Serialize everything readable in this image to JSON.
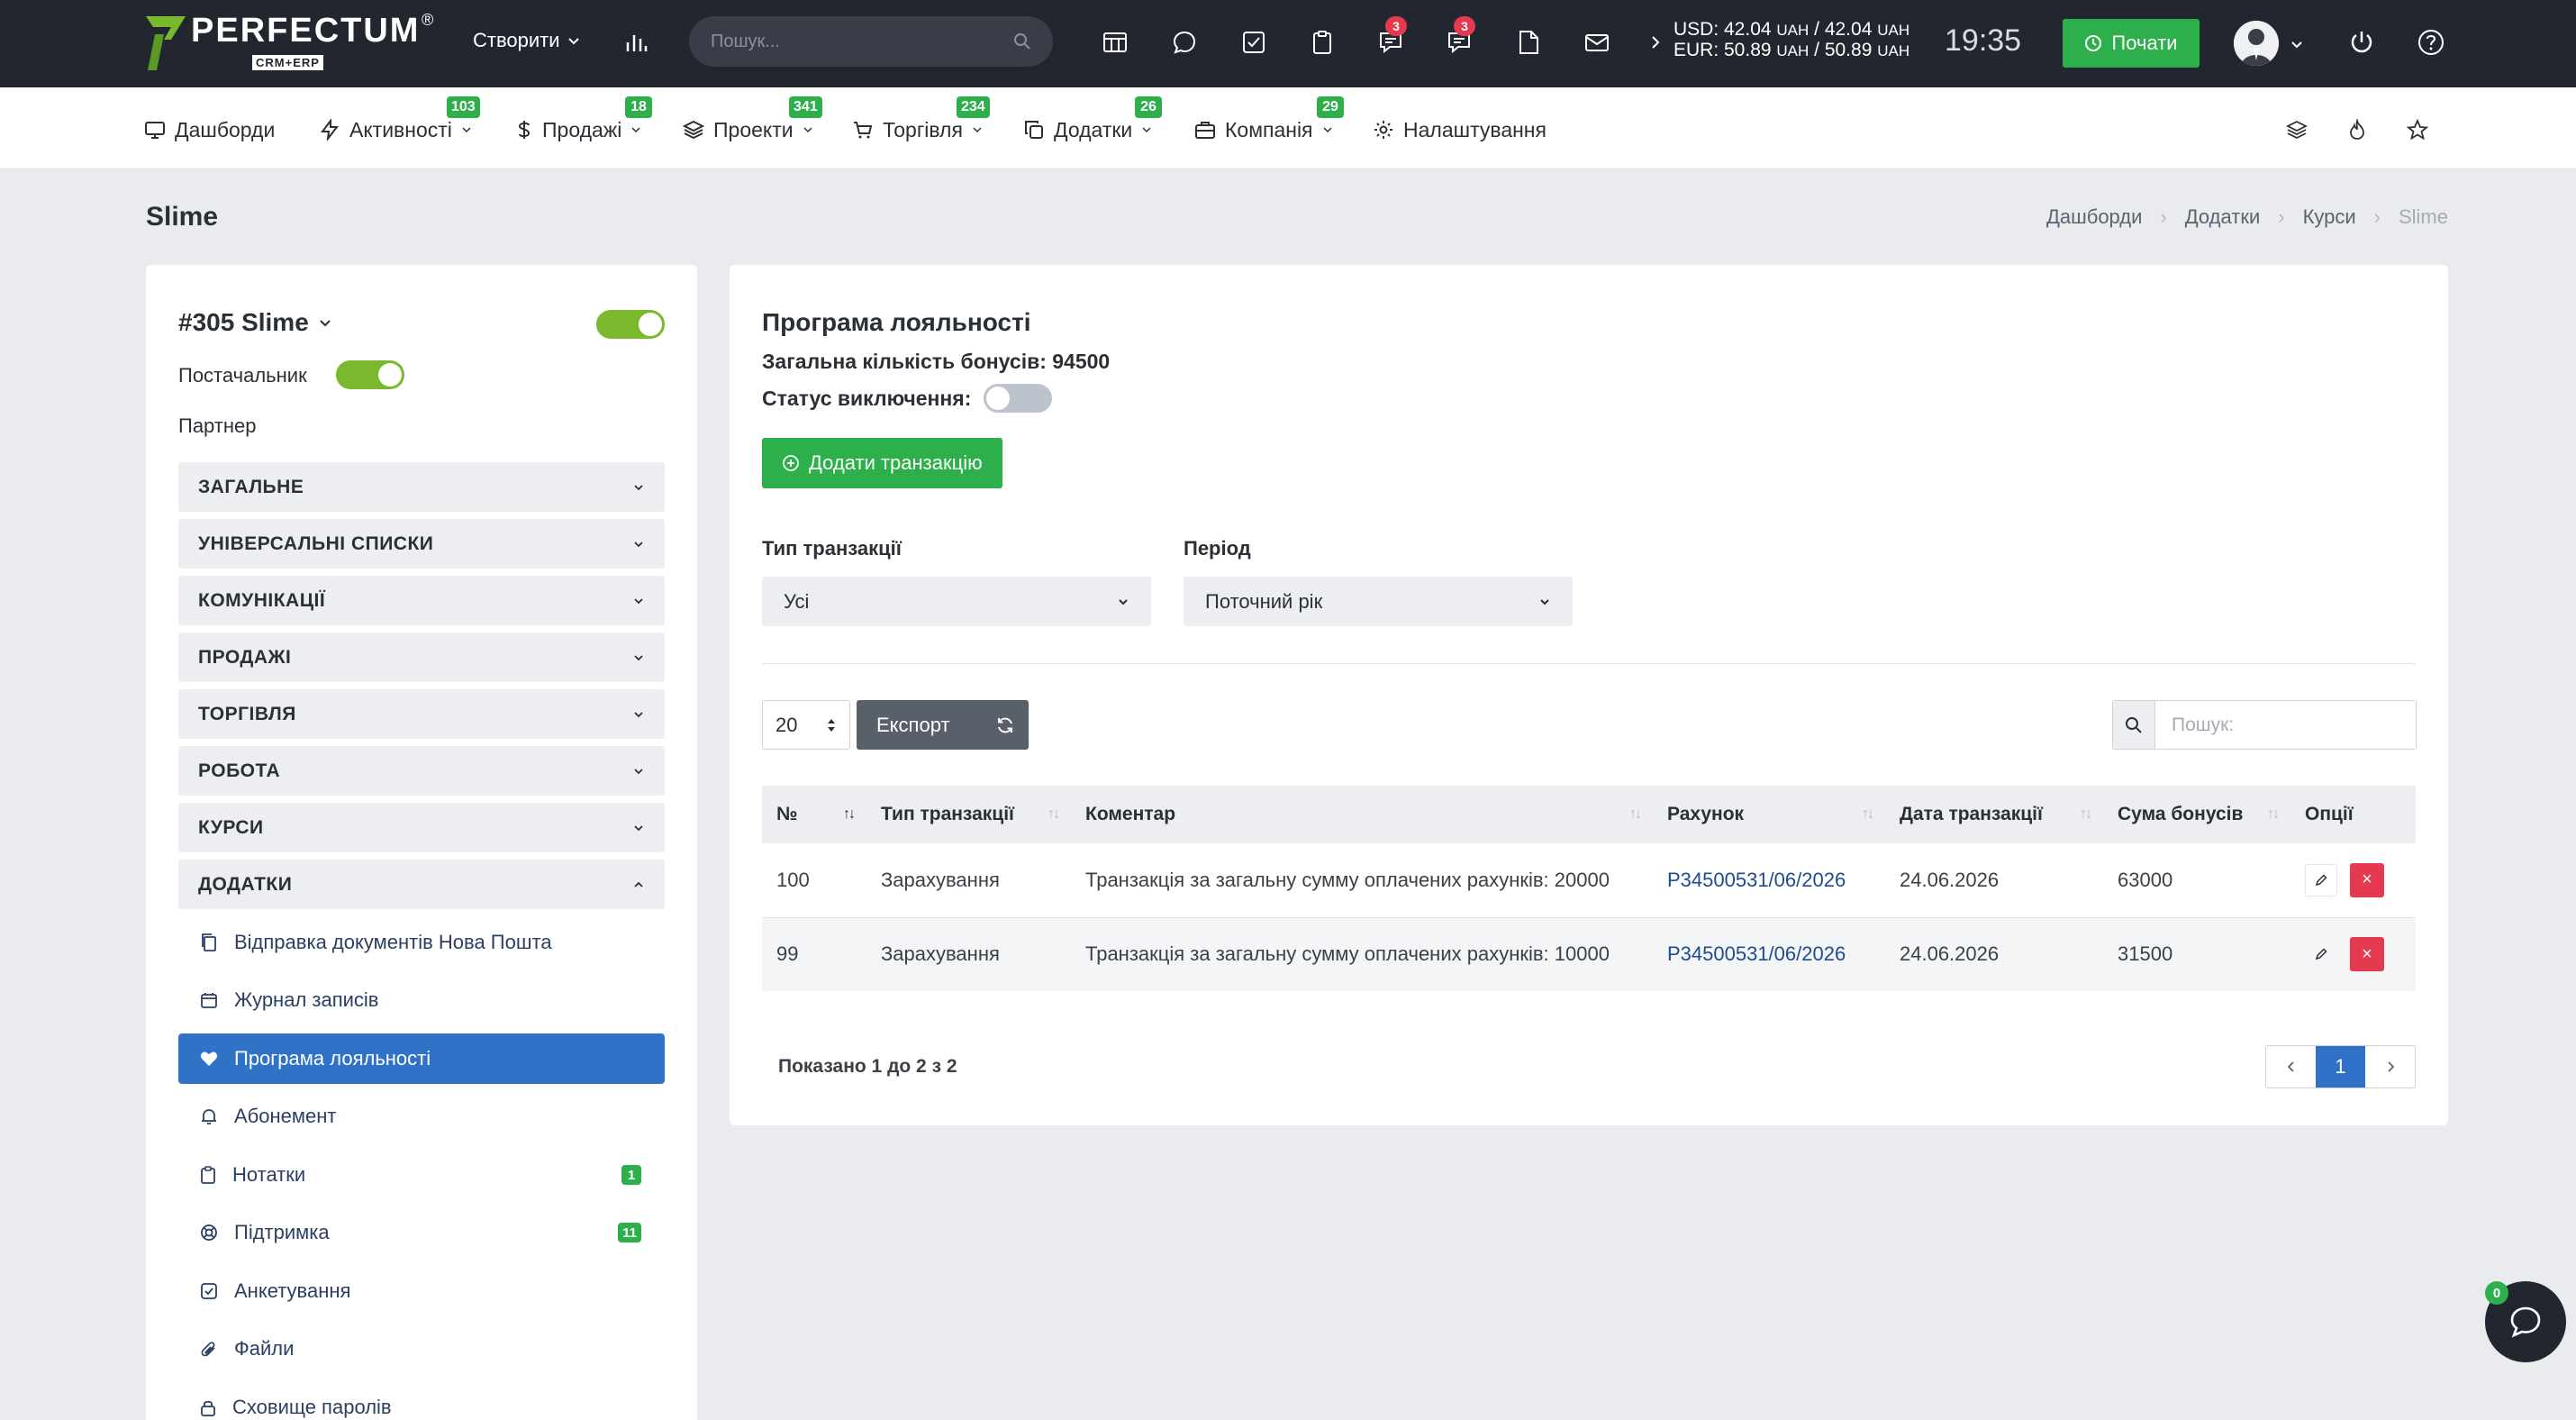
{
  "app": {
    "brand": "PERFECTUM",
    "brand_sub": "CRM+ERP",
    "brand_reg": "®"
  },
  "topbar": {
    "create_label": "Створити",
    "search_placeholder": "Пошук...",
    "badges": {
      "discussions": "3",
      "messages": "3"
    },
    "rate_usd": "USD: 42.04",
    "rate_usd_unit1": "UAH",
    "rate_usd_sep": "/ 42.04",
    "rate_usd_unit2": "UAH",
    "rate_eur": "EUR: 50.89",
    "rate_eur_unit1": "UAH",
    "rate_eur_sep": "/ 50.89",
    "rate_eur_unit2": "UAH",
    "time": "19:35",
    "start_label": "Почати"
  },
  "nav": {
    "items": [
      {
        "label": "Дашборди",
        "icon": "monitor-icon",
        "badge": ""
      },
      {
        "label": "Активності",
        "icon": "bolt-icon",
        "badge": "103"
      },
      {
        "label": "Продажі",
        "icon": "dollar-icon",
        "badge": "18"
      },
      {
        "label": "Проекти",
        "icon": "layers-icon",
        "badge": "341"
      },
      {
        "label": "Торгівля",
        "icon": "cart-icon",
        "badge": "234"
      },
      {
        "label": "Додатки",
        "icon": "copy-icon",
        "badge": "26"
      },
      {
        "label": "Компанія",
        "icon": "briefcase-icon",
        "badge": "29"
      },
      {
        "label": "Налаштування",
        "icon": "gear-icon",
        "badge": ""
      }
    ]
  },
  "page": {
    "title": "Slime",
    "breadcrumbs": [
      "Дашборди",
      "Додатки",
      "Курси",
      "Slime"
    ]
  },
  "sidebar": {
    "client_name": "#305 Slime",
    "supplier_label": "Постачальник",
    "partner_label": "Партнер",
    "sections": [
      "ЗАГАЛЬНЕ",
      "УНІВЕРСАЛЬНІ СПИСКИ",
      "КОМУНІКАЦІЇ",
      "ПРОДАЖІ",
      "ТОРГІВЛЯ",
      "РОБОТА",
      "КУРСИ",
      "ДОДАТКИ"
    ],
    "addons": [
      {
        "label": "Відправка документів Нова Пошта",
        "icon": "documents-icon",
        "badge": ""
      },
      {
        "label": "Журнал записів",
        "icon": "calendar-icon",
        "badge": ""
      },
      {
        "label": "Програма лояльності",
        "icon": "heart-icon",
        "badge": ""
      },
      {
        "label": "Абонемент",
        "icon": "bell-icon",
        "badge": ""
      },
      {
        "label": "Нотатки",
        "icon": "clipboard-icon",
        "badge": "1"
      },
      {
        "label": "Підтримка",
        "icon": "lifebuoy-icon",
        "badge": "11"
      },
      {
        "label": "Анкетування",
        "icon": "checkbox-icon",
        "badge": ""
      },
      {
        "label": "Файли",
        "icon": "paperclip-icon",
        "badge": ""
      },
      {
        "label": "Сховище паролів",
        "icon": "lock-icon",
        "badge": ""
      }
    ]
  },
  "main": {
    "title": "Програма лояльності",
    "total_bonuses": "Загальна кількість бонусів: 94500",
    "exclusion_status": "Статус виключення:",
    "add_button": "Додати транзакцію",
    "filter_type_label": "Тип транзакції",
    "filter_type_value": "Усі",
    "filter_period_label": "Період",
    "filter_period_value": "Поточний рік",
    "per_page": "20",
    "export_label": "Експорт",
    "search_placeholder": "Пошук:",
    "columns": [
      "№",
      "Тип транзакції",
      "Коментар",
      "Рахунок",
      "Дата транзакції",
      "Сума бонусів",
      "Опції"
    ],
    "rows": [
      {
        "num": "100",
        "type": "Зарахування",
        "comment": "Транзакція за загальну сумму оплачених рахунків: 20000",
        "invoice": "Р34500531/06/2026",
        "date": "24.06.2026",
        "amount": "63000"
      },
      {
        "num": "99",
        "type": "Зарахування",
        "comment": "Транзакція за загальну сумму оплачених рахунків: 10000",
        "invoice": "Р34500531/06/2026",
        "date": "24.06.2026",
        "amount": "31500"
      }
    ],
    "shown_text": "Показано 1 до 2 з 2",
    "current_page": "1"
  },
  "chat": {
    "badge": "0"
  },
  "colors": {
    "topbar": "#22262e",
    "accent_green": "#2db04b",
    "active_blue": "#3172c9",
    "danger": "#e53950"
  }
}
